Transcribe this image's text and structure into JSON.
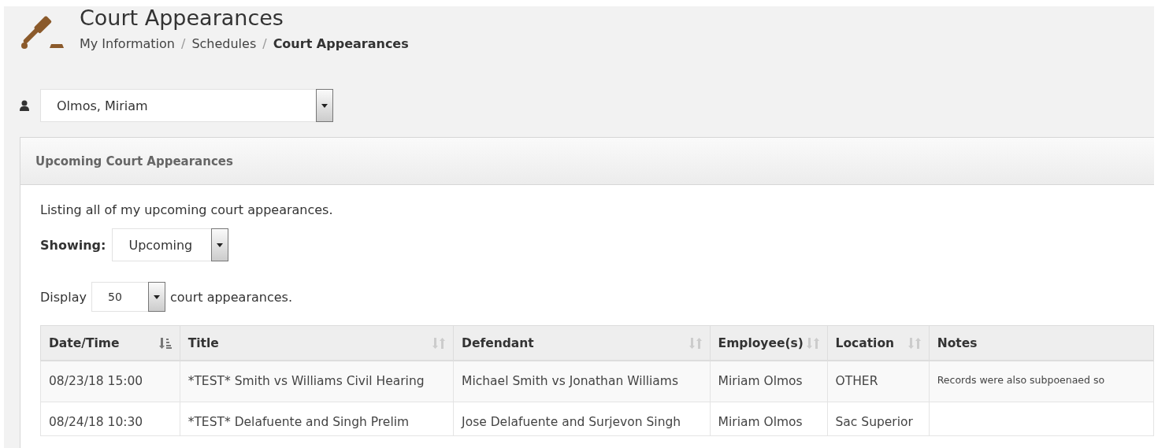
{
  "page": {
    "title": "Court Appearances"
  },
  "breadcrumbs": [
    {
      "label": "My Information",
      "current": false
    },
    {
      "separator": "/",
      "label": "Schedules",
      "current": false
    },
    {
      "separator": "/",
      "label": "Court Appearances",
      "current": true
    }
  ],
  "employee_select": {
    "value": "Olmos, Miriam"
  },
  "panel": {
    "title": "Upcoming Court Appearances",
    "description": "Listing all of my upcoming court appearances.",
    "showing": {
      "label": "Showing:",
      "value": "Upcoming"
    },
    "display": {
      "prefix": "Display",
      "value": "50",
      "suffix": "court appearances."
    }
  },
  "table": {
    "columns": [
      {
        "label": "Date/Time",
        "sortable": true,
        "sorted": true
      },
      {
        "label": "Title",
        "sortable": true,
        "sorted": false
      },
      {
        "label": "Defendant",
        "sortable": true,
        "sorted": false
      },
      {
        "label": "Employee(s)",
        "sortable": true,
        "sorted": false
      },
      {
        "label": "Location",
        "sortable": true,
        "sorted": false
      },
      {
        "label": "Notes",
        "sortable": false
      }
    ],
    "rows": [
      [
        "08/23/18 15:00",
        "*TEST* Smith vs Williams Civil Hearing",
        "Michael Smith vs Jonathan Williams",
        "Miriam Olmos",
        "OTHER",
        "Records were also subpoenaed so"
      ],
      [
        "08/24/18 10:30",
        "*TEST* Delafuente and Singh Prelim",
        "Jose Delafuente and Surjevon Singh",
        "Miriam Olmos",
        "Sac Superior",
        ""
      ]
    ]
  }
}
